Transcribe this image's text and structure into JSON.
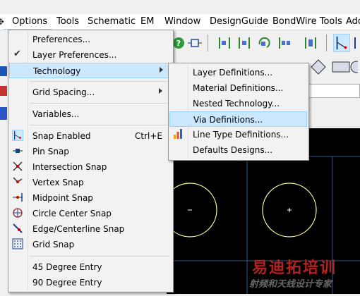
{
  "menubar": {
    "items": [
      "Options",
      "Tools",
      "Schematic",
      "EM",
      "Window",
      "DesignGuide",
      "BondWire Tools",
      "Add"
    ]
  },
  "options_menu": {
    "items": [
      {
        "label": "Preferences...",
        "shortcut": "",
        "submenu": false
      },
      {
        "label": "Layer Preferences...",
        "shortcut": "",
        "submenu": false,
        "checked": true
      },
      {
        "label": "Technology",
        "shortcut": "",
        "submenu": true,
        "highlighted": true
      },
      {
        "label": "Grid Spacing...",
        "shortcut": "",
        "submenu": true
      },
      {
        "label": "Variables...",
        "shortcut": "",
        "submenu": false
      },
      {
        "label": "Snap Enabled",
        "shortcut": "Ctrl+E",
        "submenu": false,
        "icon": "snap-enabled-icon"
      },
      {
        "label": "Pin Snap",
        "shortcut": "",
        "submenu": false,
        "icon": "pin-snap-icon"
      },
      {
        "label": "Intersection Snap",
        "shortcut": "",
        "submenu": false,
        "icon": "intersection-snap-icon"
      },
      {
        "label": "Vertex Snap",
        "shortcut": "",
        "submenu": false,
        "icon": "vertex-snap-icon"
      },
      {
        "label": "Midpoint Snap",
        "shortcut": "",
        "submenu": false,
        "icon": "midpoint-snap-icon"
      },
      {
        "label": "Circle Center Snap",
        "shortcut": "",
        "submenu": false,
        "icon": "circle-center-snap-icon"
      },
      {
        "label": "Edge/Centerline Snap",
        "shortcut": "",
        "submenu": false,
        "icon": "edge-snap-icon"
      },
      {
        "label": "Grid Snap",
        "shortcut": "",
        "submenu": false,
        "icon": "grid-snap-icon"
      },
      {
        "label": "45 Degree Entry",
        "shortcut": "",
        "submenu": false
      },
      {
        "label": "90 Degree Entry",
        "shortcut": "",
        "submenu": false
      }
    ]
  },
  "technology_submenu": {
    "items": [
      {
        "label": "Layer Definitions...",
        "highlighted": false
      },
      {
        "label": "Material Definitions...",
        "highlighted": false
      },
      {
        "label": "Nested Technology...",
        "highlighted": false
      },
      {
        "label": "Via Definitions...",
        "highlighted": true
      },
      {
        "label": "Line Type Definitions...",
        "highlighted": false,
        "icon": "bar-chart-icon"
      },
      {
        "label": "Defaults Designs...",
        "highlighted": false
      }
    ]
  },
  "watermark": {
    "line1": "易迪拓培训",
    "line2": "射频和天线设计专家"
  },
  "colors": {
    "highlight": "#cce8ff",
    "highlight_border": "#99d1ff",
    "canvas": "#000000",
    "circle": "#ffff99"
  }
}
